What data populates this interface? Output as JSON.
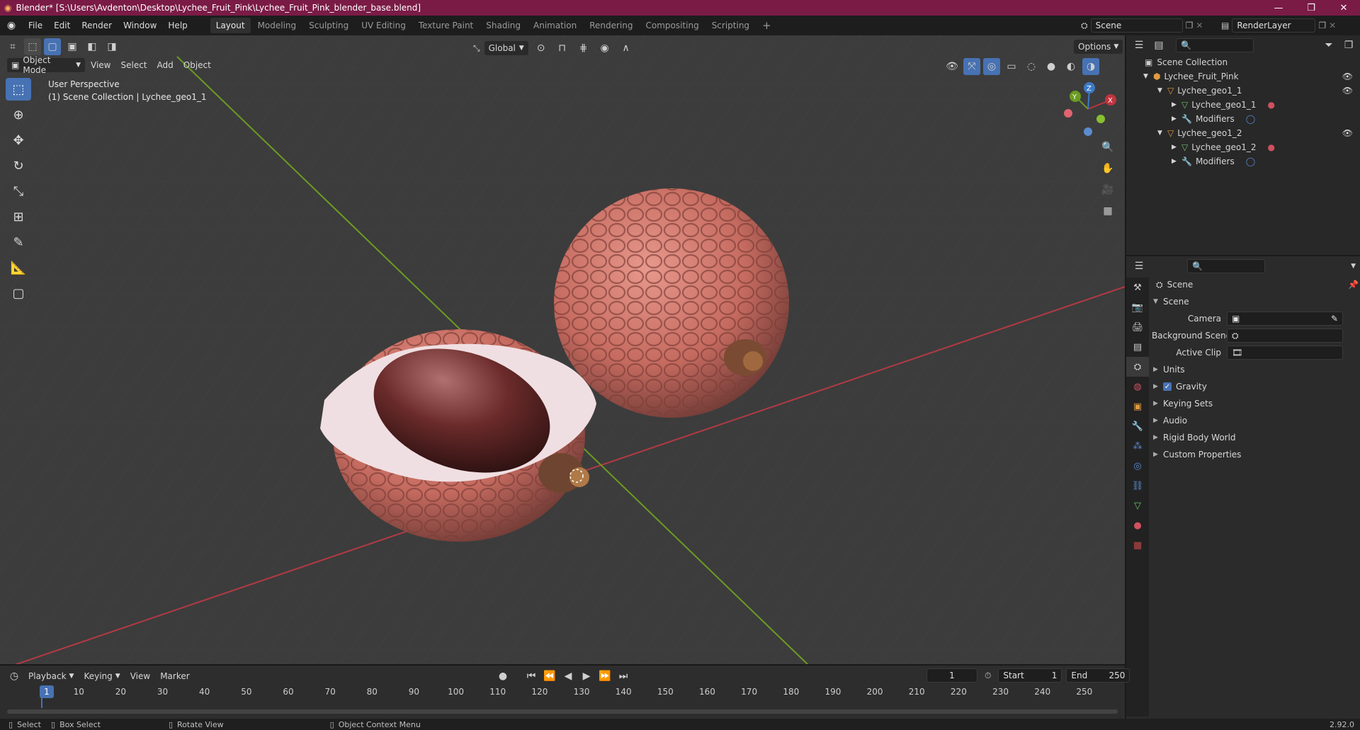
{
  "titlebar": {
    "title": "Blender* [S:\\Users\\Avdenton\\Desktop\\Lychee_Fruit_Pink\\Lychee_Fruit_Pink_blender_base.blend]"
  },
  "menu": {
    "items": [
      "File",
      "Edit",
      "Render",
      "Window",
      "Help"
    ],
    "workspaces": [
      "Layout",
      "Modeling",
      "Sculpting",
      "UV Editing",
      "Texture Paint",
      "Shading",
      "Animation",
      "Rendering",
      "Compositing",
      "Scripting"
    ],
    "active_workspace": "Layout",
    "scene": "Scene",
    "view_layer": "RenderLayer"
  },
  "viewport": {
    "mode": "Object Mode",
    "menus": [
      "View",
      "Select",
      "Add",
      "Object"
    ],
    "orientation": "Global",
    "options": "Options",
    "overlay_line1": "User Perspective",
    "overlay_line2": "(1) Scene Collection | Lychee_geo1_1",
    "gizmo_axes": [
      "X",
      "Y",
      "Z"
    ]
  },
  "outliner": {
    "root": "Scene Collection",
    "collection": "Lychee_Fruit_Pink",
    "objects": [
      {
        "name": "Lychee_geo1_1",
        "mesh": "Lychee_geo1_1",
        "modifiers": "Modifiers"
      },
      {
        "name": "Lychee_geo1_2",
        "mesh": "Lychee_geo1_2",
        "modifiers": "Modifiers"
      }
    ]
  },
  "properties": {
    "header": "Scene",
    "section": "Scene",
    "fields": [
      {
        "label": "Camera"
      },
      {
        "label": "Background Scene"
      },
      {
        "label": "Active Clip"
      }
    ],
    "panels": [
      "Units",
      "Gravity",
      "Keying Sets",
      "Audio",
      "Rigid Body World",
      "Custom Properties"
    ],
    "gravity_checked": true
  },
  "timeline": {
    "menus": [
      "Playback",
      "Keying",
      "View",
      "Marker"
    ],
    "current_frame": "1",
    "start_label": "Start",
    "start": "1",
    "end_label": "End",
    "end": "250",
    "ticks": [
      "1",
      "10",
      "20",
      "30",
      "40",
      "50",
      "60",
      "70",
      "80",
      "90",
      "100",
      "110",
      "120",
      "130",
      "140",
      "150",
      "160",
      "170",
      "180",
      "190",
      "200",
      "210",
      "220",
      "230",
      "240",
      "250"
    ]
  },
  "statusbar": {
    "select": "Select",
    "box_select": "Box Select",
    "rotate_view": "Rotate View",
    "context_menu": "Object Context Menu",
    "version": "2.92.0"
  },
  "colors": {
    "title_bar": "#7a1b46",
    "accent": "#4772b3",
    "x_axis": "#c1343e",
    "y_axis": "#6b9c22"
  }
}
